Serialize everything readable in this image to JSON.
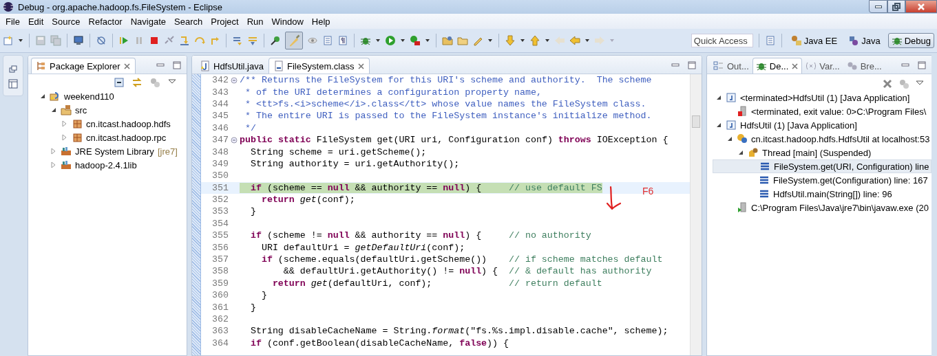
{
  "window": {
    "title": "Debug - org.apache.hadoop.fs.FileSystem - Eclipse"
  },
  "menu": [
    "File",
    "Edit",
    "Source",
    "Refactor",
    "Navigate",
    "Search",
    "Project",
    "Run",
    "Window",
    "Help"
  ],
  "quick_access": {
    "placeholder": "Quick Access"
  },
  "perspectives": [
    {
      "label": "Java EE",
      "selected": false
    },
    {
      "label": "Java",
      "selected": false
    },
    {
      "label": "Debug",
      "selected": true
    }
  ],
  "package_explorer": {
    "title": "Package Explorer",
    "tree": [
      {
        "label": "weekend110",
        "kind": "project",
        "expanded": true,
        "children": [
          {
            "label": "src",
            "kind": "source-folder",
            "expanded": true,
            "children": [
              {
                "label": "cn.itcast.hadoop.hdfs",
                "kind": "package",
                "expanded": false
              },
              {
                "label": "cn.itcast.hadoop.rpc",
                "kind": "package",
                "expanded": false
              }
            ]
          },
          {
            "label": "JRE System Library",
            "decoration": "[jre7]",
            "kind": "library",
            "expanded": false
          },
          {
            "label": "hadoop-2.4.1lib",
            "kind": "library",
            "expanded": false
          }
        ]
      }
    ]
  },
  "editor": {
    "tabs": [
      {
        "label": "HdfsUtil.java",
        "kind": "java",
        "selected": false
      },
      {
        "label": "FileSystem.class",
        "kind": "class",
        "selected": true
      }
    ],
    "lines": [
      {
        "number": "342",
        "kind": "javadoc",
        "text": "/** Returns the FileSystem for this URI's scheme and authority.  The scheme",
        "foldable": true,
        "current": false
      },
      {
        "number": "343",
        "kind": "javadoc",
        "text": " * of the URI determines a configuration property name,",
        "foldable": false,
        "current": false
      },
      {
        "number": "344",
        "kind": "javadoc",
        "text": " * <tt>fs.<i>scheme</i>.class</tt> whose value names the FileSystem class.",
        "foldable": false,
        "current": false
      },
      {
        "number": "345",
        "kind": "javadoc",
        "text": " * The entire URI is passed to the FileSystem instance's initialize method.",
        "foldable": false,
        "current": false
      },
      {
        "number": "346",
        "kind": "javadoc",
        "text": " */",
        "foldable": false,
        "current": false
      },
      {
        "number": "347",
        "kind": "code",
        "text": "**public** **static** FileSystem get(URI uri, Configuration conf) **throws** IOException {",
        "foldable": true,
        "current": false
      },
      {
        "number": "348",
        "kind": "code",
        "text": "  String scheme = uri.getScheme();",
        "foldable": false,
        "current": false
      },
      {
        "number": "349",
        "kind": "code",
        "text": "  String authority = uri.getAuthority();",
        "foldable": false,
        "current": false
      },
      {
        "number": "350",
        "kind": "blank",
        "foldable": false,
        "current": false
      },
      {
        "number": "351",
        "kind": "code",
        "text": "  **if** (scheme == **null** && authority == **null**) {",
        "comment": "// use default FS",
        "foldable": false,
        "current": true
      },
      {
        "number": "352",
        "kind": "code",
        "text": "    **return** *get*(conf);",
        "foldable": false,
        "current": false
      },
      {
        "number": "353",
        "kind": "code",
        "text": "  }",
        "foldable": false,
        "current": false
      },
      {
        "number": "354",
        "kind": "blank",
        "foldable": false,
        "current": false
      },
      {
        "number": "355",
        "kind": "code",
        "text": "  **if** (scheme != **null** && authority == **null**) {",
        "comment": "// no authority",
        "foldable": false,
        "current": false
      },
      {
        "number": "356",
        "kind": "code",
        "text": "    URI defaultUri = *getDefaultUri*(conf);",
        "foldable": false,
        "current": false
      },
      {
        "number": "357",
        "kind": "code",
        "text": "    **if** (scheme.equals(defaultUri.getScheme())",
        "comment": "// if scheme matches default",
        "foldable": false,
        "current": false
      },
      {
        "number": "358",
        "kind": "code",
        "text": "        && defaultUri.getAuthority() != **null**) {",
        "comment": "// & default has authority",
        "foldable": false,
        "current": false
      },
      {
        "number": "359",
        "kind": "code",
        "text": "      **return** *get*(defaultUri, conf);",
        "comment": "// return default",
        "foldable": false,
        "current": false
      },
      {
        "number": "360",
        "kind": "code",
        "text": "    }",
        "foldable": false,
        "current": false
      },
      {
        "number": "361",
        "kind": "code",
        "text": "  }",
        "foldable": false,
        "current": false
      },
      {
        "number": "362",
        "kind": "blank",
        "foldable": false,
        "current": false
      },
      {
        "number": "363",
        "kind": "code",
        "text": "  String disableCacheName = String.*format*(\"fs.%s.impl.disable.cache\", scheme);",
        "foldable": false,
        "current": false
      },
      {
        "number": "364",
        "kind": "code",
        "text": "  **if** (conf.getBoolean(disableCacheName, **false**)) {",
        "foldable": false,
        "current": false
      }
    ]
  },
  "annotation": {
    "text": "F6"
  },
  "debug_view": {
    "tabs": [
      {
        "label": "Out...",
        "kind": "outline",
        "selected": false
      },
      {
        "label": "De...",
        "kind": "debug",
        "selected": true
      },
      {
        "label": "Var...",
        "kind": "variables",
        "selected": false
      },
      {
        "label": "Bre...",
        "kind": "breakpoints",
        "selected": false
      }
    ],
    "tree": [
      {
        "label": "<terminated>HdfsUtil (1) [Java Application]",
        "kind": "launch",
        "expanded": true,
        "selected": false,
        "children": [
          {
            "label": "<terminated, exit value: 0>C:\\Program Files\\",
            "kind": "terminated-process",
            "selected": false
          }
        ]
      },
      {
        "label": "HdfsUtil (1) [Java Application]",
        "kind": "launch",
        "expanded": true,
        "selected": false,
        "children": [
          {
            "label": "cn.itcast.hadoop.hdfs.HdfsUtil at localhost:53",
            "kind": "target",
            "expanded": true,
            "selected": false,
            "children": [
              {
                "label": "Thread [main] (Suspended)",
                "kind": "thread",
                "expanded": true,
                "selected": false,
                "children": [
                  {
                    "label": "FileSystem.get(URI, Configuration) line",
                    "kind": "frame",
                    "selected": true
                  },
                  {
                    "label": "FileSystem.get(Configuration) line: 167",
                    "kind": "frame",
                    "selected": false
                  },
                  {
                    "label": "HdfsUtil.main(String[]) line: 96",
                    "kind": "frame",
                    "selected": false
                  }
                ]
              }
            ]
          },
          {
            "label": "C:\\Program Files\\Java\\jre7\\bin\\javaw.exe (20",
            "kind": "process",
            "selected": false
          }
        ]
      }
    ]
  }
}
